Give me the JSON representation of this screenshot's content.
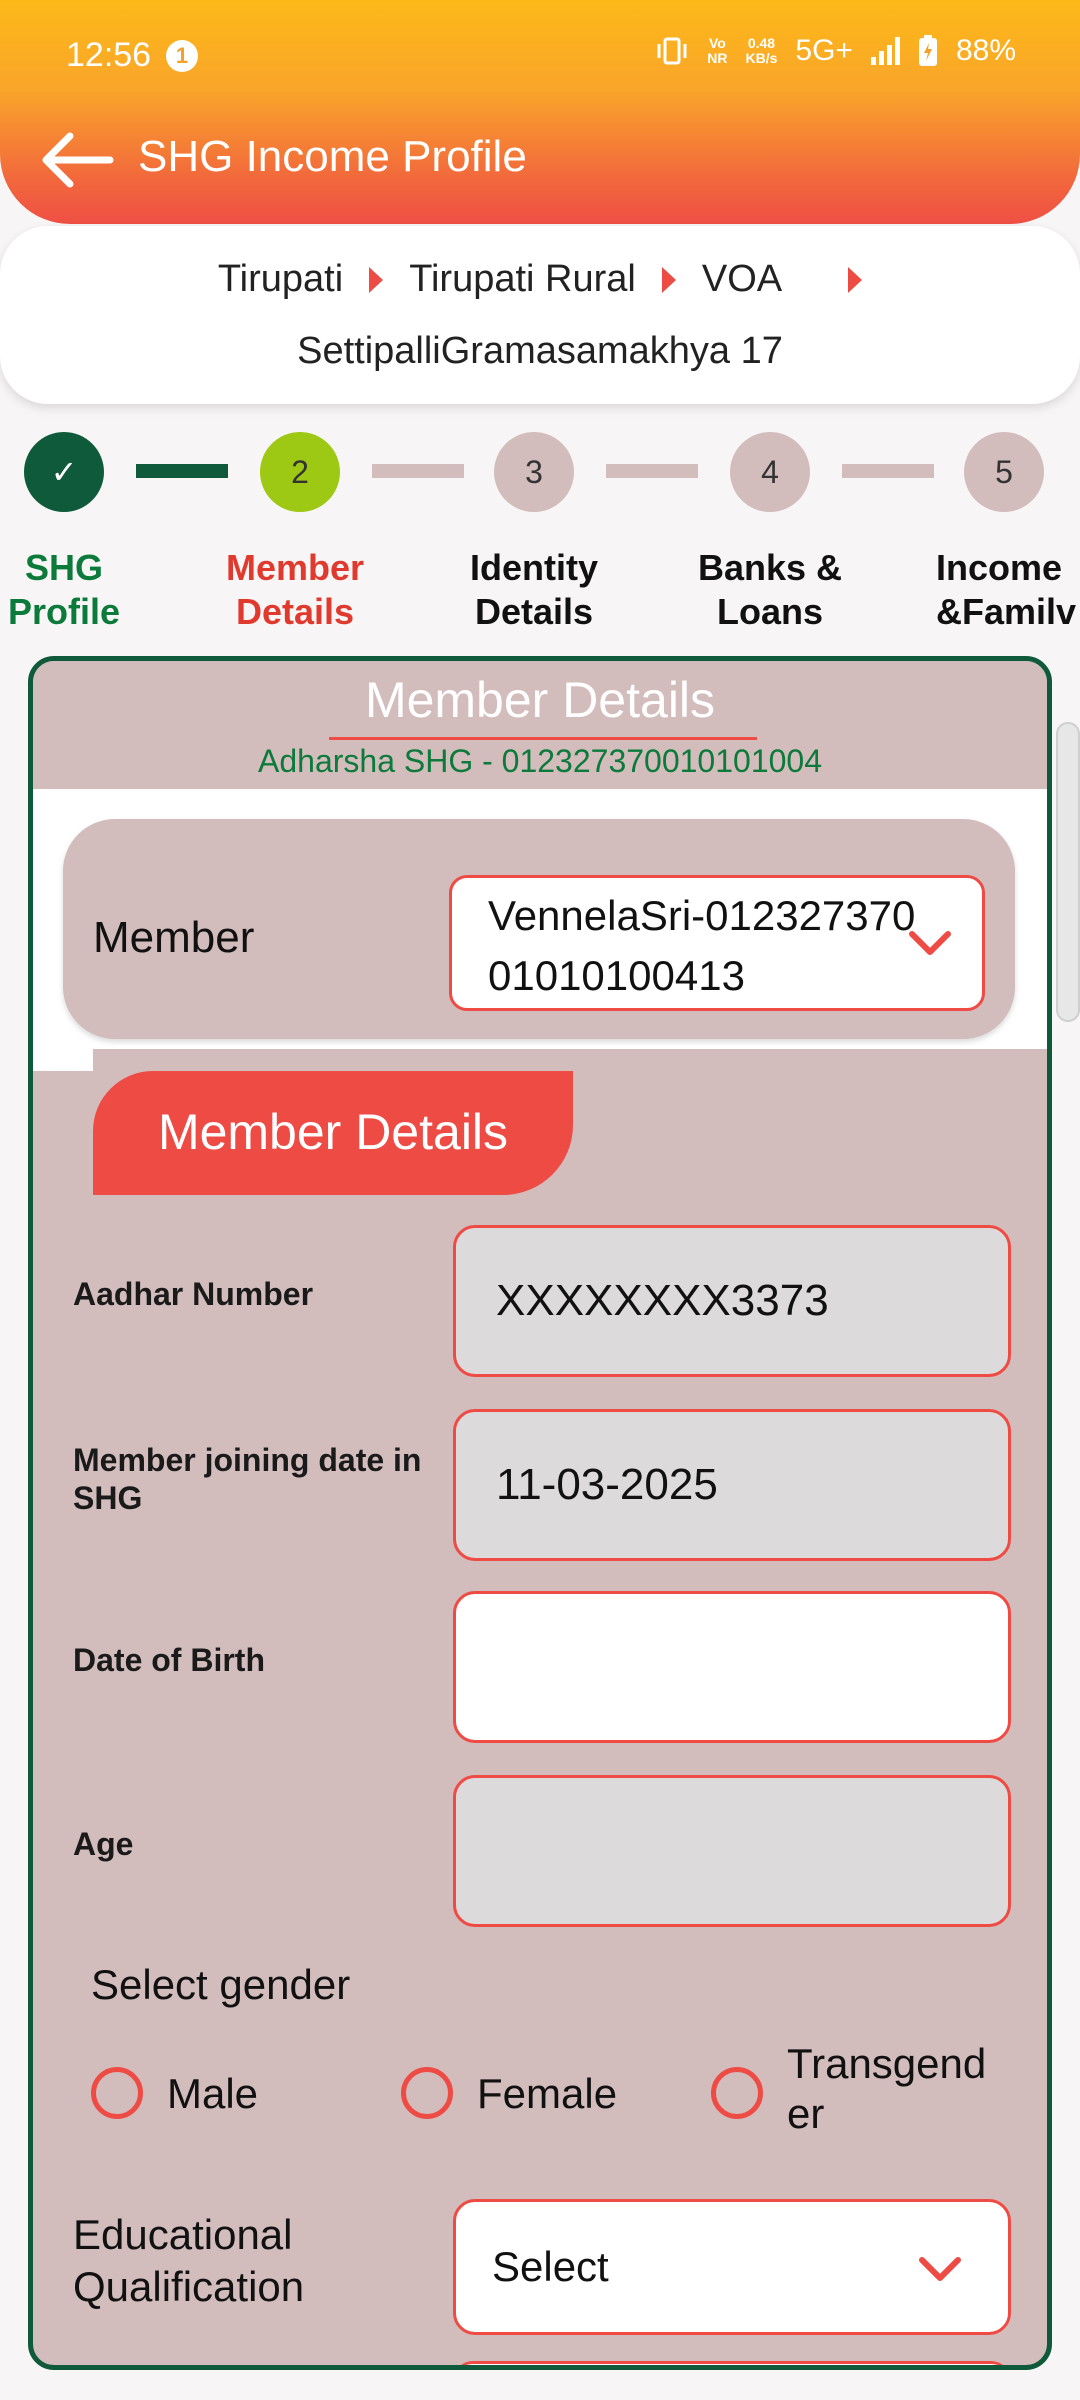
{
  "status_bar": {
    "time": "12:56",
    "notification_count": "1",
    "net_speed_top": "0.48",
    "net_speed_bottom": "KB/s",
    "volte_top": "Vo",
    "volte_bottom": "NR",
    "network": "5G+",
    "battery": "88%"
  },
  "app_bar": {
    "title": "SHG Income Profile"
  },
  "breadcrumb": {
    "items": [
      "Tirupati",
      "Tirupati Rural",
      "VOA"
    ],
    "last": "SettipalliGramasamakhya 17"
  },
  "stepper": {
    "steps": [
      {
        "number": "✓",
        "label_line1": "SHG",
        "label_line2": "Profile",
        "state": "done"
      },
      {
        "number": "2",
        "label_line1": "Member",
        "label_line2": "Details",
        "state": "active"
      },
      {
        "number": "3",
        "label_line1": "Identity",
        "label_line2": "Details",
        "state": "pending"
      },
      {
        "number": "4",
        "label_line1": "Banks &",
        "label_line2": "Loans",
        "state": "pending"
      },
      {
        "number": "5",
        "label_line1": "Income",
        "label_line2": "&Familv",
        "state": "pending"
      }
    ],
    "colors": {
      "done": "#0e5a3a",
      "active": "#9dc814",
      "pending": "#d2bcbc",
      "active_label": "#e03a2f",
      "done_label": "#0c7a3a"
    }
  },
  "panel": {
    "title": "Member Details",
    "subtitle": "Adharsha SHG - 012327370010101004",
    "member_label": "Member",
    "member_value_line1": "VennelaSri-012327370",
    "member_value_line2": "01010100413",
    "tab_title": "Member Details",
    "fields": {
      "aadhar_label": "Aadhar Number",
      "aadhar_value": "XXXXXXXX3373",
      "joining_label_line1": "Member joining date in",
      "joining_label_line2": "SHG",
      "joining_value": "11-03-2025",
      "dob_label": "Date of Birth",
      "dob_value": "",
      "age_label": "Age",
      "age_value": ""
    },
    "gender": {
      "label": "Select gender",
      "options": [
        "Male",
        "Female",
        "Transgend",
        "er"
      ]
    },
    "education": {
      "label_line1": "Educational",
      "label_line2": "Qualification",
      "selected": "Select"
    }
  },
  "theme": {
    "accent": "#ef4b45",
    "panel_bg": "#d2bcbc",
    "border_green": "#0e5a3a"
  }
}
